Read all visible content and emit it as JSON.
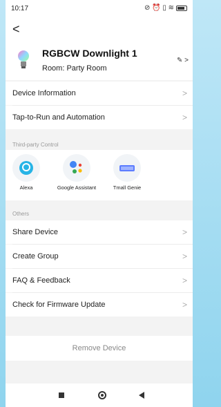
{
  "status": {
    "time": "10:17",
    "icons": "⊘ ⏰ ▯ ≋"
  },
  "header": {
    "back": "<",
    "title": "RGBCW Downlight 1",
    "room": "Room: Party Room",
    "edit": "✎ >"
  },
  "rows": {
    "device_info": "Device Information",
    "tap_to_run": "Tap-to-Run and Automation",
    "share": "Share Device",
    "create_group": "Create Group",
    "faq": "FAQ & Feedback",
    "firmware": "Check for Firmware Update"
  },
  "third_party": {
    "label": "Third-party Control",
    "items": [
      {
        "label": "Alexa"
      },
      {
        "label": "Google Assistant"
      },
      {
        "label": "Tmall Genie"
      }
    ]
  },
  "others_label": "Others",
  "remove": "Remove Device",
  "chevron": ">"
}
